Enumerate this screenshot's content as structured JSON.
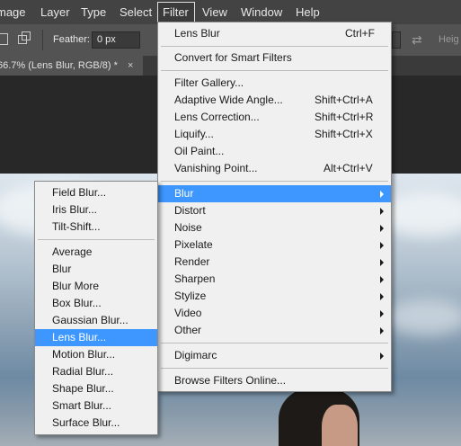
{
  "menubar": {
    "items": [
      {
        "label": "mage",
        "active": false
      },
      {
        "label": "Layer",
        "active": false
      },
      {
        "label": "Type",
        "active": false
      },
      {
        "label": "Select",
        "active": false
      },
      {
        "label": "Filter",
        "active": true
      },
      {
        "label": "View",
        "active": false
      },
      {
        "label": "Window",
        "active": false
      },
      {
        "label": "Help",
        "active": false
      }
    ]
  },
  "options_bar": {
    "feather_label": "Feather:",
    "feather_value": "0 px",
    "height_label": "Heig"
  },
  "document_tab": {
    "title": "66.7% (Lens Blur, RGB/8) *",
    "close": "×"
  },
  "filter_menu": {
    "groups": [
      [
        {
          "label": "Lens Blur",
          "shortcut": "Ctrl+F"
        }
      ],
      [
        {
          "label": "Convert for Smart Filters",
          "shortcut": ""
        }
      ],
      [
        {
          "label": "Filter Gallery...",
          "shortcut": ""
        },
        {
          "label": "Adaptive Wide Angle...",
          "shortcut": "Shift+Ctrl+A"
        },
        {
          "label": "Lens Correction...",
          "shortcut": "Shift+Ctrl+R"
        },
        {
          "label": "Liquify...",
          "shortcut": "Shift+Ctrl+X"
        },
        {
          "label": "Oil Paint...",
          "shortcut": ""
        },
        {
          "label": "Vanishing Point...",
          "shortcut": "Alt+Ctrl+V"
        }
      ],
      [
        {
          "label": "Blur",
          "submenu": true,
          "highlighted": true
        },
        {
          "label": "Distort",
          "submenu": true
        },
        {
          "label": "Noise",
          "submenu": true
        },
        {
          "label": "Pixelate",
          "submenu": true
        },
        {
          "label": "Render",
          "submenu": true
        },
        {
          "label": "Sharpen",
          "submenu": true
        },
        {
          "label": "Stylize",
          "submenu": true
        },
        {
          "label": "Video",
          "submenu": true
        },
        {
          "label": "Other",
          "submenu": true
        }
      ],
      [
        {
          "label": "Digimarc",
          "submenu": true
        }
      ],
      [
        {
          "label": "Browse Filters Online...",
          "shortcut": ""
        }
      ]
    ]
  },
  "blur_submenu": {
    "groups": [
      [
        {
          "label": "Field Blur..."
        },
        {
          "label": "Iris Blur..."
        },
        {
          "label": "Tilt-Shift..."
        }
      ],
      [
        {
          "label": "Average"
        },
        {
          "label": "Blur"
        },
        {
          "label": "Blur More"
        },
        {
          "label": "Box Blur..."
        },
        {
          "label": "Gaussian Blur..."
        },
        {
          "label": "Lens Blur...",
          "highlighted": true
        },
        {
          "label": "Motion Blur..."
        },
        {
          "label": "Radial Blur..."
        },
        {
          "label": "Shape Blur..."
        },
        {
          "label": "Smart Blur..."
        },
        {
          "label": "Surface Blur..."
        }
      ]
    ]
  },
  "colors": {
    "highlight": "#3d97ff",
    "menu_bg": "#f0f0f0",
    "menubar_bg": "#434343"
  }
}
